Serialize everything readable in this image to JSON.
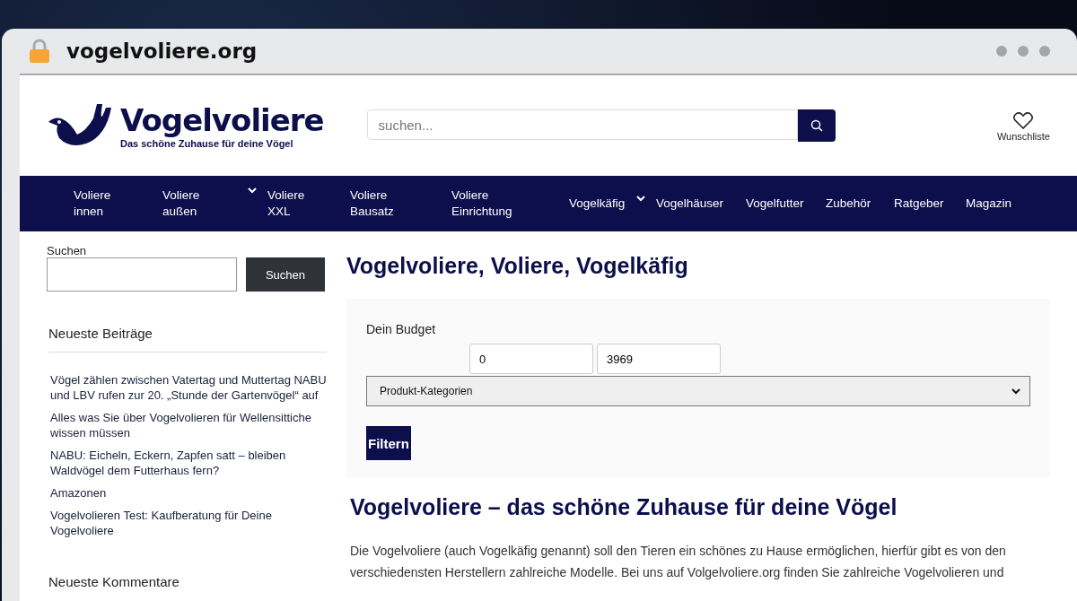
{
  "browser": {
    "url": "vogelvoliere.org"
  },
  "header": {
    "logo": {
      "name": "Vogelvoliere",
      "tagline": "Das schöne Zuhause für deine Vögel"
    },
    "search": {
      "placeholder": "suchen..."
    },
    "wishlist": "Wunschliste"
  },
  "nav": [
    {
      "label": "Voliere innen",
      "has_submenu": false
    },
    {
      "label": "Voliere außen",
      "has_submenu": true
    },
    {
      "label": "Voliere XXL",
      "has_submenu": false
    },
    {
      "label": "Voliere Bausatz",
      "has_submenu": false
    },
    {
      "label": "Voliere Einrichtung",
      "has_submenu": false
    },
    {
      "label": "Vogelkäfig",
      "has_submenu": true
    },
    {
      "label": "Vogelhäuser",
      "has_submenu": false
    },
    {
      "label": "Vogelfutter",
      "has_submenu": false
    },
    {
      "label": "Zubehör",
      "has_submenu": false
    },
    {
      "label": "Ratgeber",
      "has_submenu": false
    },
    {
      "label": "Magazin",
      "has_submenu": false
    }
  ],
  "sidebar": {
    "search_label": "Suchen",
    "search_button": "Suchen",
    "recent_posts_title": "Neueste Beiträge",
    "recent_posts": [
      "Vögel zählen zwischen Vatertag und Muttertag NABU und LBV rufen zur 20. „Stunde der Gartenvögel“ auf",
      "Alles was Sie über Vogelvolieren für Wellensittiche wissen müssen",
      "NABU: Eicheln, Eckern, Zapfen satt – bleiben Waldvögel dem Futterhaus fern?",
      "Amazonen",
      "Vogelvolieren Test: Kaufberatung für Deine Vogelvoliere"
    ],
    "recent_comments_title": "Neueste Kommentare"
  },
  "main": {
    "title": "Vogelvoliere, Voliere, Vogelkäfig",
    "filter": {
      "budget_label": "Dein Budget",
      "min": "0",
      "max": "3969",
      "category": "Produkt-Kategorien",
      "button": "Filtern"
    },
    "heading": "Vogelvoliere – das schöne Zuhause für deine Vögel",
    "paragraph": "Die Vogelvoliere (auch Vogelkäfig genannt) soll den Tieren ein schönes zu Hause ermöglichen, hierfür gibt es von den verschiedensten Herstellern zahlreiche Modelle. Bei uns auf Volgelvoliere.org finden Sie zahlreiche Vogelvolieren und"
  }
}
